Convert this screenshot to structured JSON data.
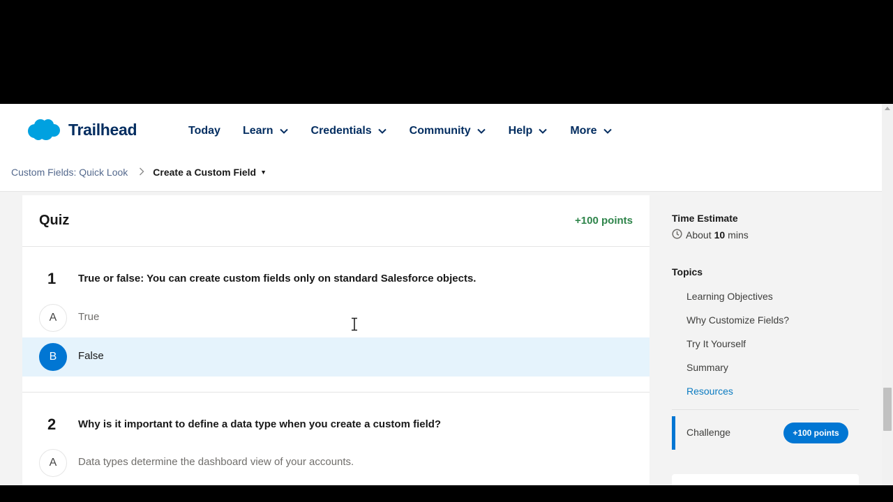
{
  "header": {
    "brand": "Trailhead",
    "nav": [
      {
        "label": "Today",
        "has_menu": false
      },
      {
        "label": "Learn",
        "has_menu": true
      },
      {
        "label": "Credentials",
        "has_menu": true
      },
      {
        "label": "Community",
        "has_menu": true
      },
      {
        "label": "Help",
        "has_menu": true
      },
      {
        "label": "More",
        "has_menu": true
      }
    ]
  },
  "breadcrumb": {
    "parent": "Custom Fields: Quick Look",
    "current": "Create a Custom Field"
  },
  "quiz": {
    "title": "Quiz",
    "points": "+100 points",
    "questions": [
      {
        "number": "1",
        "text": "True or false: You can create custom fields only on standard Salesforce objects.",
        "answers": [
          {
            "letter": "A",
            "text": "True",
            "selected": false
          },
          {
            "letter": "B",
            "text": "False",
            "selected": true
          }
        ]
      },
      {
        "number": "2",
        "text": "Why is it important to define a data type when you create a custom field?",
        "answers": [
          {
            "letter": "A",
            "text": "Data types determine the dashboard view of your accounts.",
            "selected": false
          }
        ]
      }
    ]
  },
  "sidebar": {
    "time_label": "Time Estimate",
    "time_prefix": "About",
    "time_value": "10",
    "time_unit": "mins",
    "topics_label": "Topics",
    "topics": [
      {
        "label": "Learning Objectives",
        "active": false
      },
      {
        "label": "Why Customize Fields?",
        "active": false
      },
      {
        "label": "Try It Yourself",
        "active": false
      },
      {
        "label": "Summary",
        "active": false
      },
      {
        "label": "Resources",
        "active": true
      }
    ],
    "challenge_label": "Challenge",
    "challenge_points": "+100 points"
  },
  "colors": {
    "brand_blue": "#0176d3",
    "nav_text": "#032d60",
    "points_green": "#2e844a",
    "selected_bg": "#e5f3fc"
  }
}
